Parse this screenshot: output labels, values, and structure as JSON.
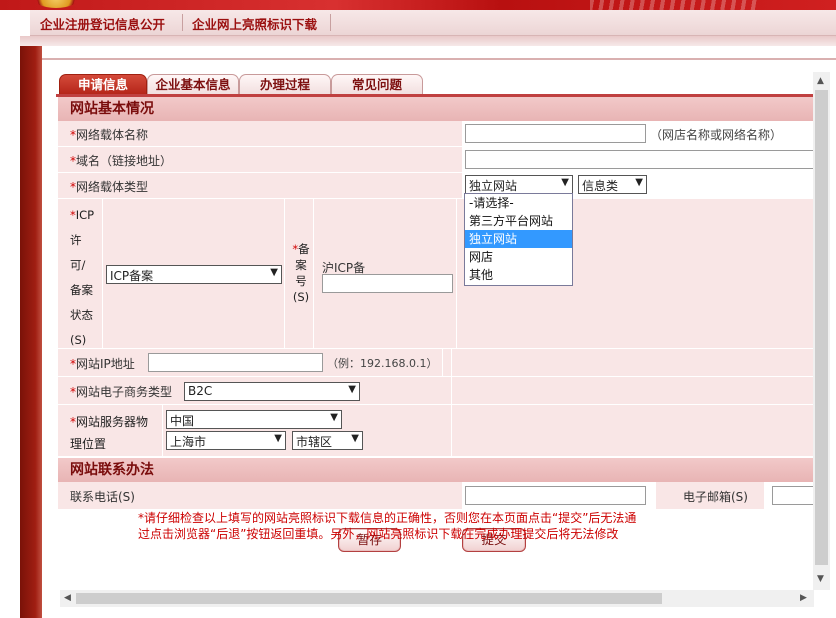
{
  "top_nav": {
    "items": [
      "企业注册登记信息公开",
      "企业网上亮照标识下载"
    ]
  },
  "tabs": [
    "申请信息",
    "企业基本信息",
    "办理过程",
    "常见问题"
  ],
  "section1": {
    "title": "网站基本情况",
    "req_mark": "*",
    "carrier_name": {
      "label": "网络载体名称",
      "value": "",
      "hint": "（网店名称或网络名称）"
    },
    "domain": {
      "label": "域名（链接地址）",
      "value": ""
    },
    "carrier_type": {
      "label": "网络载体类型",
      "selected": "独立网站",
      "category_selected": "信息类",
      "options": [
        "-请选择-",
        "第三方平台网站",
        "独立网站",
        "网店",
        "其他"
      ]
    },
    "icp_status": {
      "label_lines": [
        "ICP",
        "许",
        "可/",
        "备案",
        "状态",
        "(S)"
      ],
      "selected": "ICP备案"
    },
    "icp_number": {
      "label_lines": [
        "备",
        "案",
        "号",
        "(S)"
      ],
      "prefix": "沪ICP备",
      "value": ""
    },
    "ip": {
      "label": "网站IP地址",
      "value": "",
      "hint": "（例：192.168.0.1）"
    },
    "ecommerce_type": {
      "label": "网站电子商务类型",
      "selected": "B2C"
    },
    "server_location": {
      "label_line1": "网站服务器物",
      "label_line2": "理位置",
      "country": "中国",
      "city": "上海市",
      "district": "市辖区"
    }
  },
  "section2": {
    "title": "网站联系办法",
    "phone_label": "联系电话(S)",
    "email_label": "电子邮箱(S)"
  },
  "buttons": {
    "save": "暂存",
    "submit": "提交"
  },
  "notice": {
    "line1": "*请仔细检查以上填写的网站亮照标识下载信息的正确性，否则您在本页面点击“提交”后无法通",
    "line2": "过点击浏览器“后退”按钮返回重填。另外，网站亮照标识下载在完成办理提交后将无法修改"
  },
  "icons": {
    "dropdown": "▼",
    "scroll_up": "▲",
    "scroll_down": "▼",
    "scroll_left": "◀",
    "scroll_right": "▶"
  }
}
